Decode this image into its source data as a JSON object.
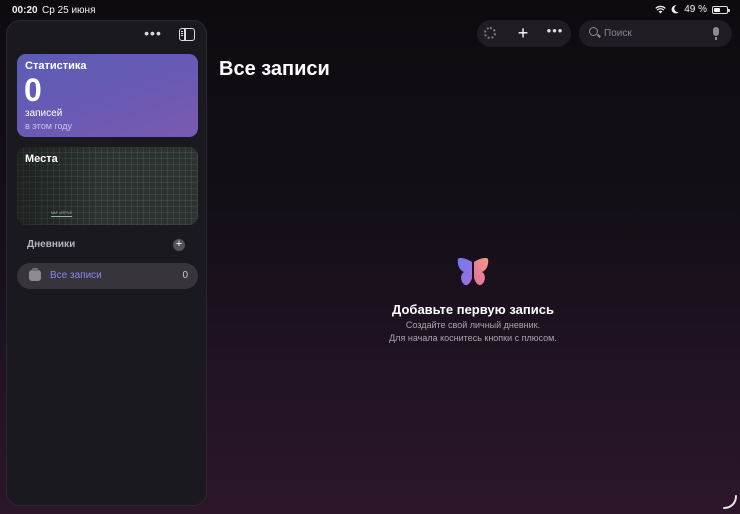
{
  "status_bar": {
    "time": "00:20",
    "date": "Ср 25 июня",
    "battery": "49 %",
    "battery_level": 0.49,
    "icons": [
      "wifi-icon",
      "moon-icon",
      "battery-icon"
    ]
  },
  "sidebar": {
    "stats_card": {
      "title": "Статистика",
      "count": "0",
      "unit": "записей",
      "period": "в этом году",
      "accent": "#6a5ab4"
    },
    "places_card": {
      "title": "Места"
    },
    "journals_section": {
      "title": "Дневники"
    },
    "journals": [
      {
        "label": "Все записи",
        "count": "0",
        "selected": true
      }
    ]
  },
  "toolbar": {
    "icons": [
      "sync-spinner-icon",
      "plus-icon",
      "more-icon"
    ]
  },
  "search": {
    "placeholder": "Поиск"
  },
  "main": {
    "title": "Все записи",
    "empty_state": {
      "title": "Добавьте первую запись",
      "line1": "Создайте свой личный дневник.",
      "line2": "Для начала коснитесь кнопки с плюсом."
    }
  }
}
